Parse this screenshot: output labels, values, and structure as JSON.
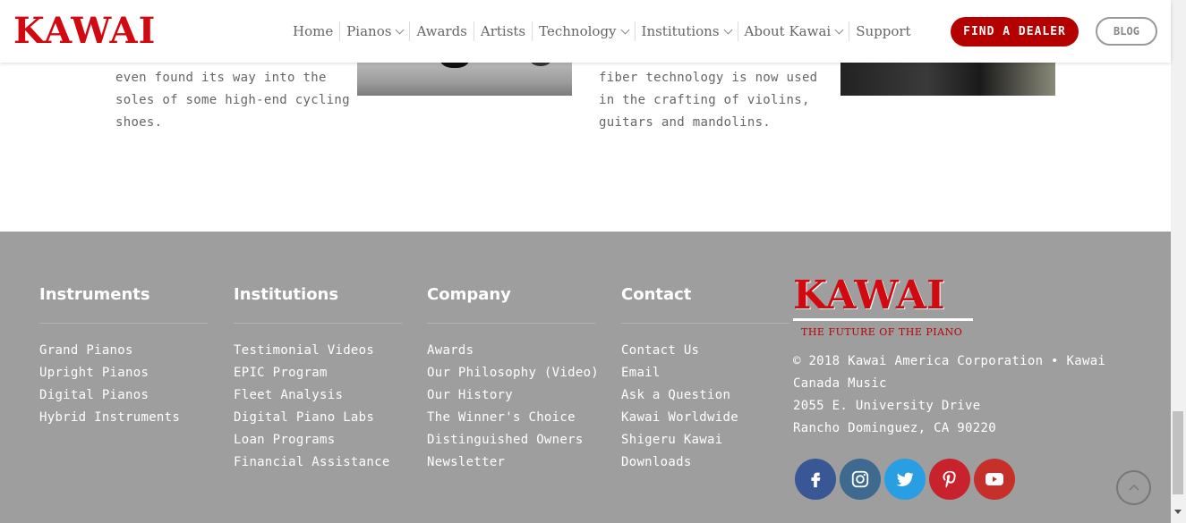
{
  "header": {
    "logo": "KAWAI",
    "nav": [
      {
        "label": "Home",
        "dropdown": false
      },
      {
        "label": "Pianos",
        "dropdown": true
      },
      {
        "label": "Awards",
        "dropdown": false
      },
      {
        "label": "Artists",
        "dropdown": false
      },
      {
        "label": "Technology",
        "dropdown": true
      },
      {
        "label": "Institutions",
        "dropdown": true
      },
      {
        "label": "About Kawai",
        "dropdown": true
      },
      {
        "label": "Support",
        "dropdown": false
      }
    ],
    "find_dealer": "FIND A DEALER",
    "blog": "BLOG"
  },
  "content": {
    "left_para": "even found its way into the\nsoles of some high-end cycling\nshoes.",
    "right_para": "fiber technology is now used\nin the crafting of violins,\nguitars and mandolins."
  },
  "footer": {
    "columns": [
      {
        "title": "Instruments",
        "links": [
          "Grand Pianos",
          "Upright Pianos",
          "Digital Pianos",
          "Hybrid Instruments"
        ]
      },
      {
        "title": "Institutions",
        "links": [
          "Testimonial Videos",
          "EPIC Program",
          "Fleet Analysis",
          "Digital Piano Labs",
          "Loan Programs",
          "Financial Assistance"
        ]
      },
      {
        "title": "Company",
        "links": [
          "Awards",
          "Our Philosophy (Video)",
          "Our History",
          "The Winner's Choice",
          "Distinguished Owners",
          "Newsletter"
        ]
      },
      {
        "title": "Contact",
        "links": [
          "Contact Us",
          "Email",
          "Ask a Question",
          "Kawai Worldwide",
          "Shigeru Kawai",
          "Downloads"
        ]
      }
    ],
    "logo": "KAWAI",
    "tagline": "THE FUTURE OF THE PIANO",
    "copyright": "© 2018 Kawai America Corporation • Kawai Canada Music",
    "address1": "2055 E. University Drive",
    "address2": "Rancho Dominguez, CA 90220",
    "social": [
      "facebook-icon",
      "instagram-icon",
      "twitter-icon",
      "pinterest-icon",
      "youtube-icon"
    ]
  },
  "colors": {
    "brand_red": "#d10a11",
    "dealer_button": "#b50000",
    "footer_bg": "#9e9e9e"
  }
}
